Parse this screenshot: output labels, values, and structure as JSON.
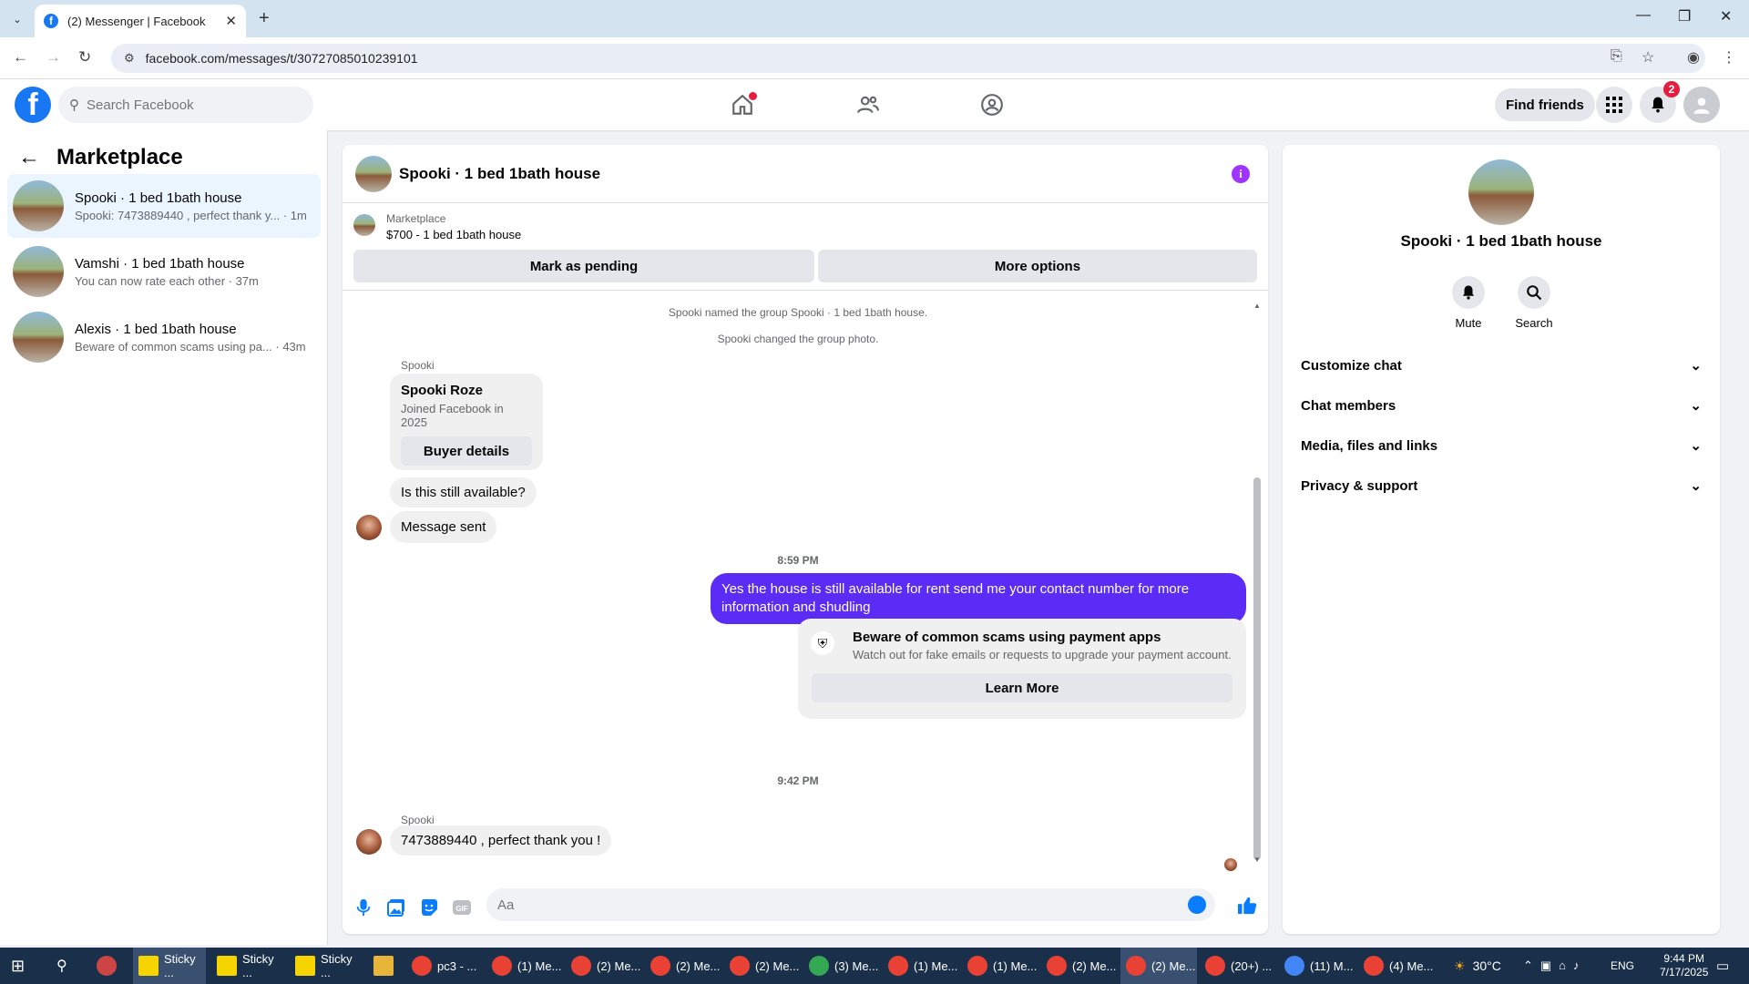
{
  "browser": {
    "tab_title": "(2) Messenger | Facebook",
    "url": "facebook.com/messages/t/30727085010239101"
  },
  "fb_header": {
    "search_placeholder": "Search Facebook",
    "find_friends": "Find friends",
    "notification_count": "2"
  },
  "sidebar": {
    "title": "Marketplace",
    "conversations": [
      {
        "name": "Spooki · 1 bed 1bath house",
        "preview": "Spooki: 7473889440 , perfect thank y... · 1m"
      },
      {
        "name": "Vamshi · 1 bed 1bath house",
        "preview": "You can now rate each other · 37m"
      },
      {
        "name": "Alexis · 1 bed 1bath house",
        "preview": "Beware of common scams using pa... · 43m"
      }
    ]
  },
  "chat": {
    "title": "Spooki · 1 bed 1bath house",
    "marketplace_label": "Marketplace",
    "listing": "$700 - 1 bed 1bath house",
    "mark_pending": "Mark as pending",
    "more_options": "More options",
    "sys1": "Spooki named the group Spooki · 1 bed 1bath house.",
    "sys2": "Spooki changed the group photo.",
    "sender": "Spooki",
    "card_name": "Spooki Roze",
    "card_sub": "Joined Facebook in 2025",
    "buyer_details": "Buyer details",
    "msg1": "Is this still available?",
    "msg2": "Message sent",
    "time1": "8:59 PM",
    "out_msg": "Yes the house is still available for rent send me your contact number for more information and shudling",
    "scam_title": "Beware of common scams using payment apps",
    "scam_body": "Watch out for fake emails or requests to upgrade your payment account.",
    "learn_more": "Learn More",
    "time2": "9:42 PM",
    "msg3": "7473889440 , perfect thank you !",
    "composer_placeholder": "Aa"
  },
  "details": {
    "title": "Spooki · 1 bed 1bath house",
    "mute": "Mute",
    "search": "Search",
    "rows": [
      "Customize chat",
      "Chat members",
      "Media, files and links",
      "Privacy & support"
    ]
  },
  "taskbar": {
    "items": [
      "Sticky ...",
      "Sticky ...",
      "Sticky ...",
      "pc3 - ...",
      "(1) Me...",
      "(2) Me...",
      "(2) Me...",
      "(2) Me...",
      "(3) Me...",
      "(1) Me...",
      "(1) Me...",
      "(2) Me...",
      "(2) Me...",
      "(20+) ...",
      "(11) M...",
      "(4) Me..."
    ],
    "temperature": "30°C",
    "language": "ENG",
    "time": "9:44 PM",
    "date": "7/17/2025"
  }
}
